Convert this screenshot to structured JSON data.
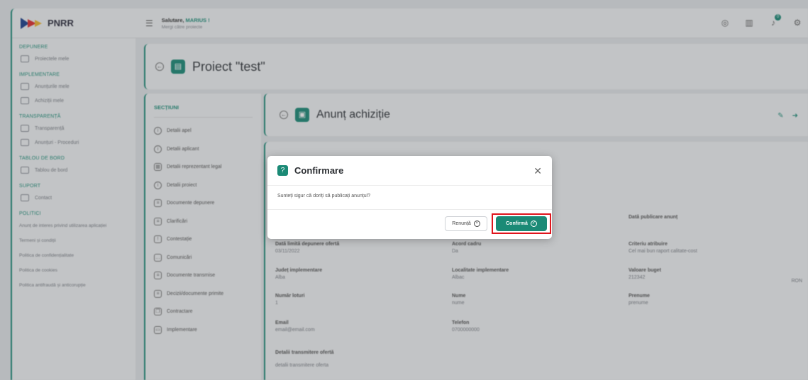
{
  "brand": {
    "name": "PNRR"
  },
  "header": {
    "greeting_prefix": "Salutare, ",
    "user": "MARIUS !",
    "subtitle": "Mergi către proiecte",
    "notif_count": "0"
  },
  "sidebar": {
    "depunere": "DEPUNERE",
    "proiectele_mele": "Proiectele mele",
    "implementare": "IMPLEMENTARE",
    "anunturile_mele": "Anunțurile mele",
    "achizitiile_mele": "Achiziții mele",
    "transparenta_sec": "TRANSPARENȚĂ",
    "transparenta": "Transparență",
    "anunturi_proceduri": "Anunțuri - Proceduri",
    "tablou_sec": "TABLOU DE BORD",
    "tablou": "Tablou de bord",
    "suport": "SUPORT",
    "contact": "Contact",
    "politici": "POLITICI",
    "links": [
      "Anunț de interes privind utilizarea aplicației",
      "Termeni și condiții",
      "Politica de confidențialitate",
      "Politica de cookies",
      "Politica antifraudă și anticorupție"
    ]
  },
  "project": {
    "title": "Proiect \"test\""
  },
  "sections": {
    "heading": "SECȚIUNI",
    "items": [
      "Detalii apel",
      "Detalii aplicant",
      "Detalii reprezentant legal",
      "Detalii proiect",
      "Documente depunere",
      "Clarificări",
      "Contestație",
      "Comunicări",
      "Documente transmise",
      "Decizii/documente primite",
      "Contractare",
      "Implementare"
    ]
  },
  "anunt": {
    "title": "Anunț achiziție"
  },
  "details": {
    "data_publicare_label": "Dată publicare anunț",
    "data_limita_label": "Dată limită depunere ofertă",
    "data_limita": "03/11/2022",
    "acord_label": "Acord cadru",
    "acord": "Da",
    "criteriu_label": "Criteriu atribuire",
    "criteriu": "Cel mai bun raport calitate-cost",
    "judet_label": "Județ implementare",
    "judet": "Alba",
    "localitate_label": "Localitate implementare",
    "localitate": "Albac",
    "buget_label": "Valoare buget",
    "buget": "212342",
    "moneda": "RON",
    "loturi_label": "Număr loturi",
    "loturi": "1",
    "nume_label": "Nume",
    "nume": "nume",
    "prenume_label": "Prenume",
    "prenume": "prenume",
    "email_label": "Email",
    "email": "email@email.com",
    "telefon_label": "Telefon",
    "telefon": "0700000000",
    "transmitere_label": "Detalii transmitere ofertă",
    "transmitere": "detalii transmitere oferta"
  },
  "modal": {
    "title": "Confirmare",
    "message": "Sunteți sigur că doriți să publicați anunțul?",
    "cancel": "Renunță",
    "confirm": "Confirmă"
  },
  "colors": {
    "accent": "#1b8a76",
    "highlight": "#e0141c"
  }
}
